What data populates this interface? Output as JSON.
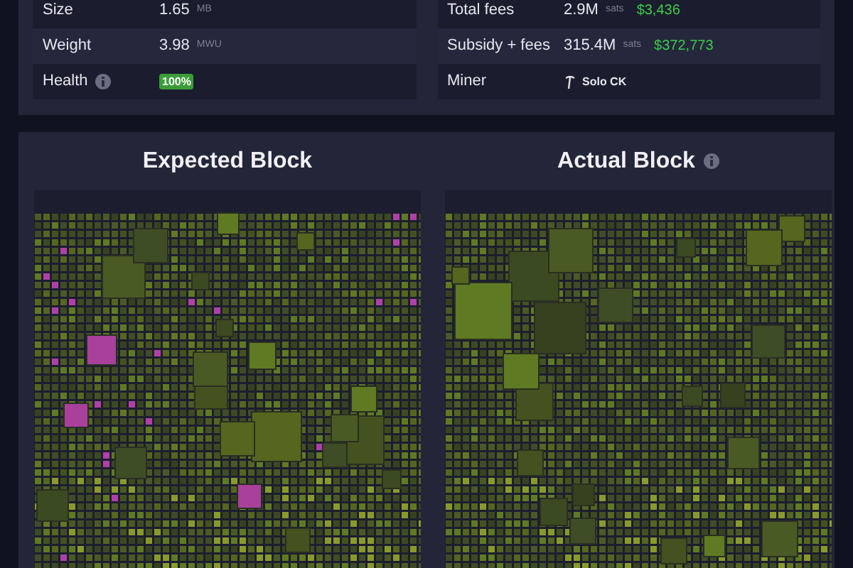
{
  "stats_left": [
    {
      "label": "Size",
      "value": "1.65",
      "unit": "MB"
    },
    {
      "label": "Weight",
      "value": "3.98",
      "unit": "MWU"
    },
    {
      "label": "Health",
      "info": true,
      "badge": "100%"
    }
  ],
  "stats_right": [
    {
      "label": "Total fees",
      "value": "2.9M",
      "unit": "sats",
      "fiat": "$3,436"
    },
    {
      "label": "Subsidy + fees",
      "value": "315.4M",
      "unit": "sats",
      "fiat": "$372,773"
    },
    {
      "label": "Miner",
      "miner": "Solo CK"
    }
  ],
  "blocks": [
    {
      "title": "Expected Block",
      "info": false,
      "highlight": true
    },
    {
      "title": "Actual Block",
      "info": true,
      "highlight": false
    }
  ]
}
